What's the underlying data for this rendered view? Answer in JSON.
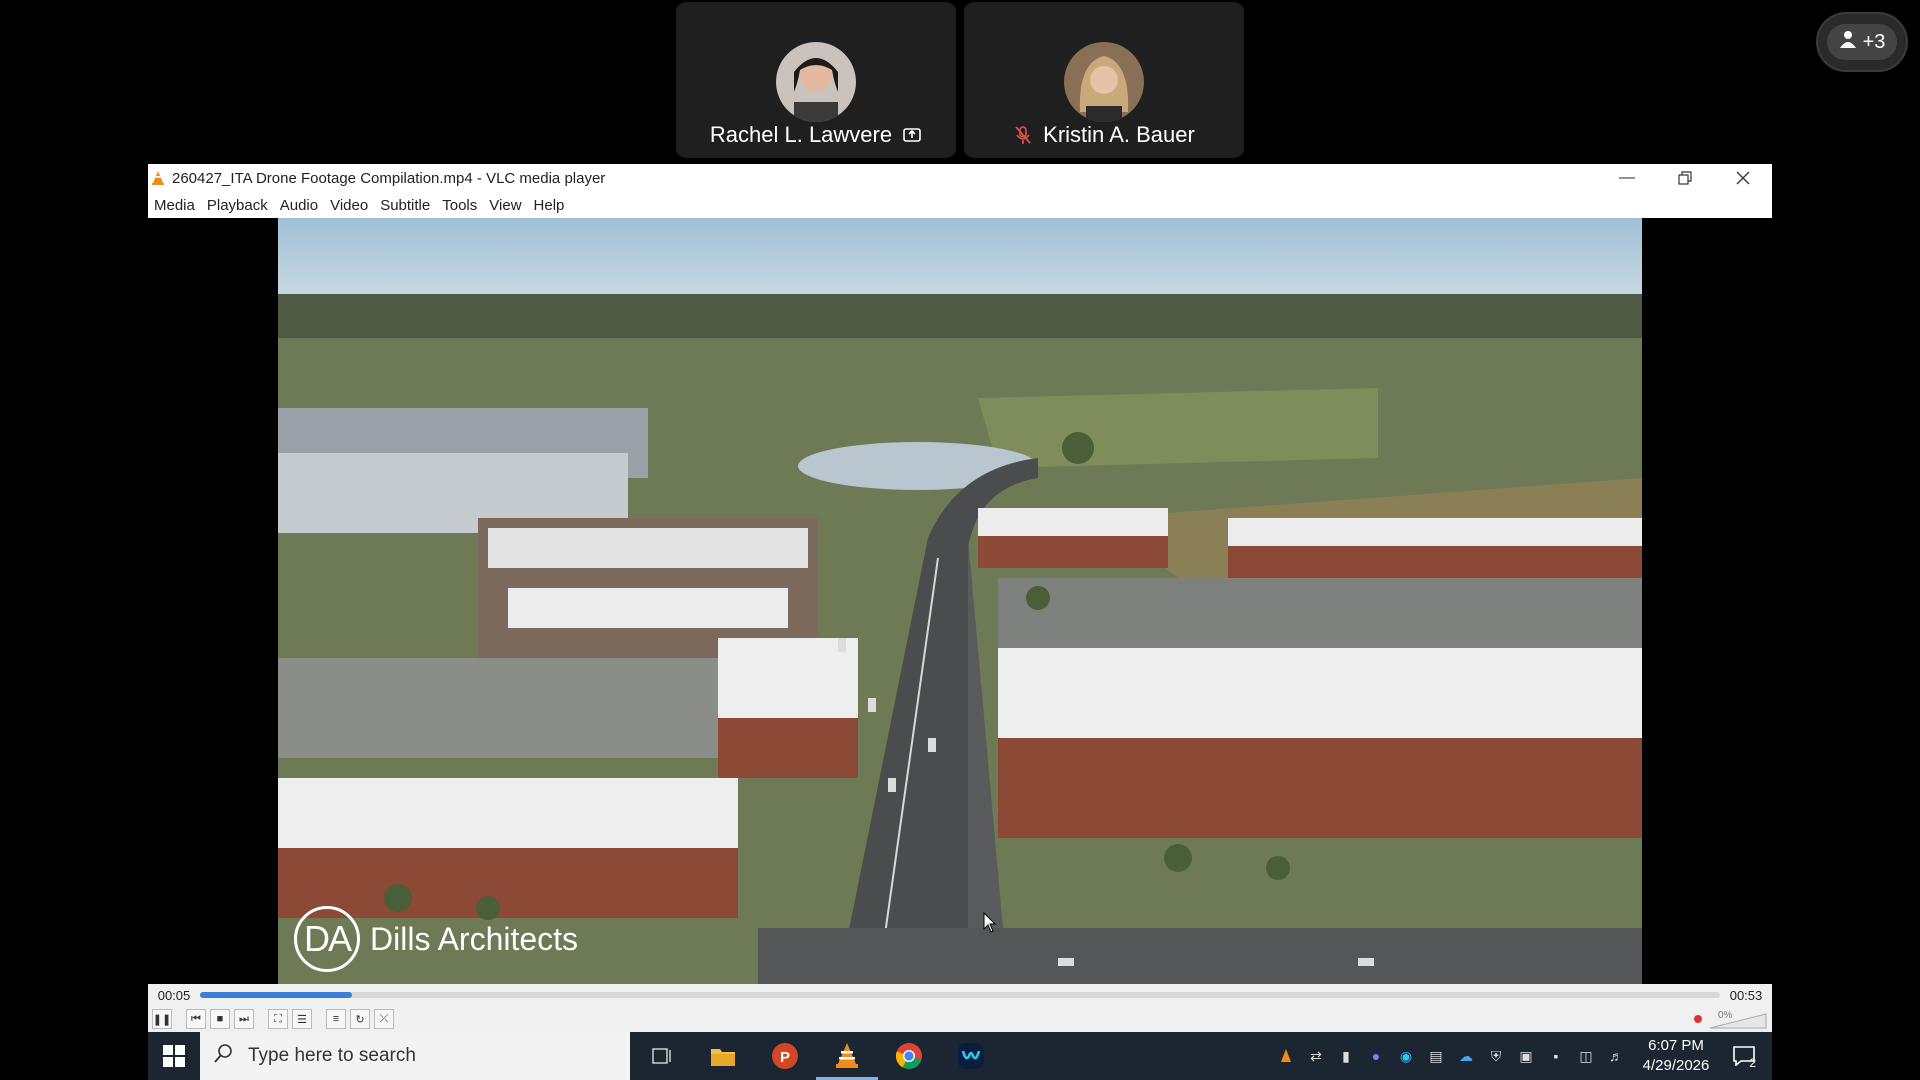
{
  "participants": [
    {
      "name": "Rachel L. Lawvere",
      "status_icon": "screen-share-icon"
    },
    {
      "name": "Kristin A. Bauer",
      "status_icon": "muted-mic-icon"
    }
  ],
  "more_participants": {
    "label": "+3"
  },
  "vlc": {
    "title": "260427_ITA Drone Footage Compilation.mp4 - VLC media player",
    "menu": [
      "Media",
      "Playback",
      "Audio",
      "Video",
      "Subtitle",
      "Tools",
      "View",
      "Help"
    ],
    "elapsed": "00:05",
    "duration": "00:53",
    "progress_fraction": 0.1,
    "volume_label": "0%"
  },
  "watermark": {
    "logo_text": "DA",
    "company": "Dills Architects"
  },
  "taskbar": {
    "search_placeholder": "Type here to search",
    "time": "6:07 PM",
    "date": "4/29/2026",
    "notification_count": "2"
  },
  "colors": {
    "sky": "#a9c6d8",
    "grass": "#6f8c4a",
    "accent": "#3b7fd4",
    "taskbar": "#1c2633"
  }
}
